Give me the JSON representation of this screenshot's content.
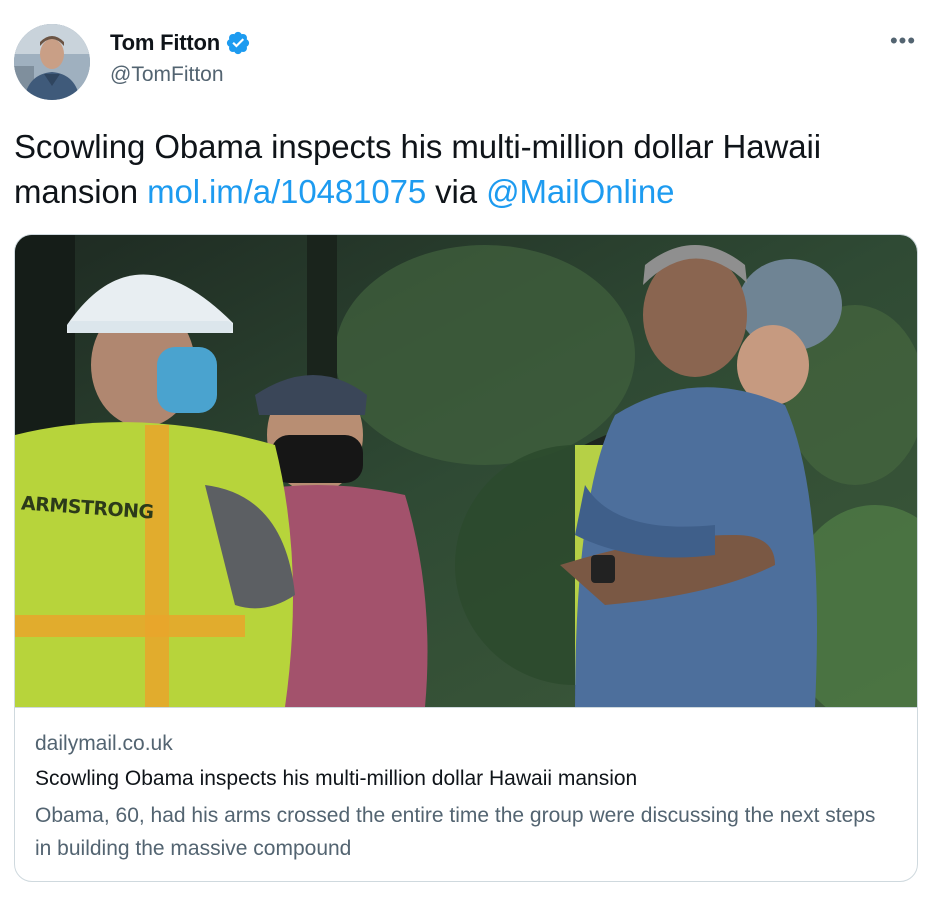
{
  "tweet": {
    "author": {
      "display_name": "Tom Fitton",
      "handle": "@TomFitton",
      "verified": true,
      "verified_icon": "verified-badge-icon"
    },
    "more_icon": "more-options-icon",
    "more_glyph": "•••",
    "text_parts": {
      "plain_1": "Scowling Obama inspects his multi-million dollar Hawaii mansion ",
      "link_url": "mol.im/a/10481075",
      "plain_2": " via ",
      "mention": "@MailOnline"
    }
  },
  "card": {
    "domain": "dailymail.co.uk",
    "title": "Scowling Obama inspects his multi-million dollar Hawaii mansion",
    "description": "Obama, 60, had his arms crossed the entire time the group were discussing the next steps in building the massive compound",
    "image_vest_text": "ARMSTRONG"
  },
  "colors": {
    "link": "#1d9bf0",
    "secondary_text": "#536471",
    "border": "#cfd9de"
  }
}
